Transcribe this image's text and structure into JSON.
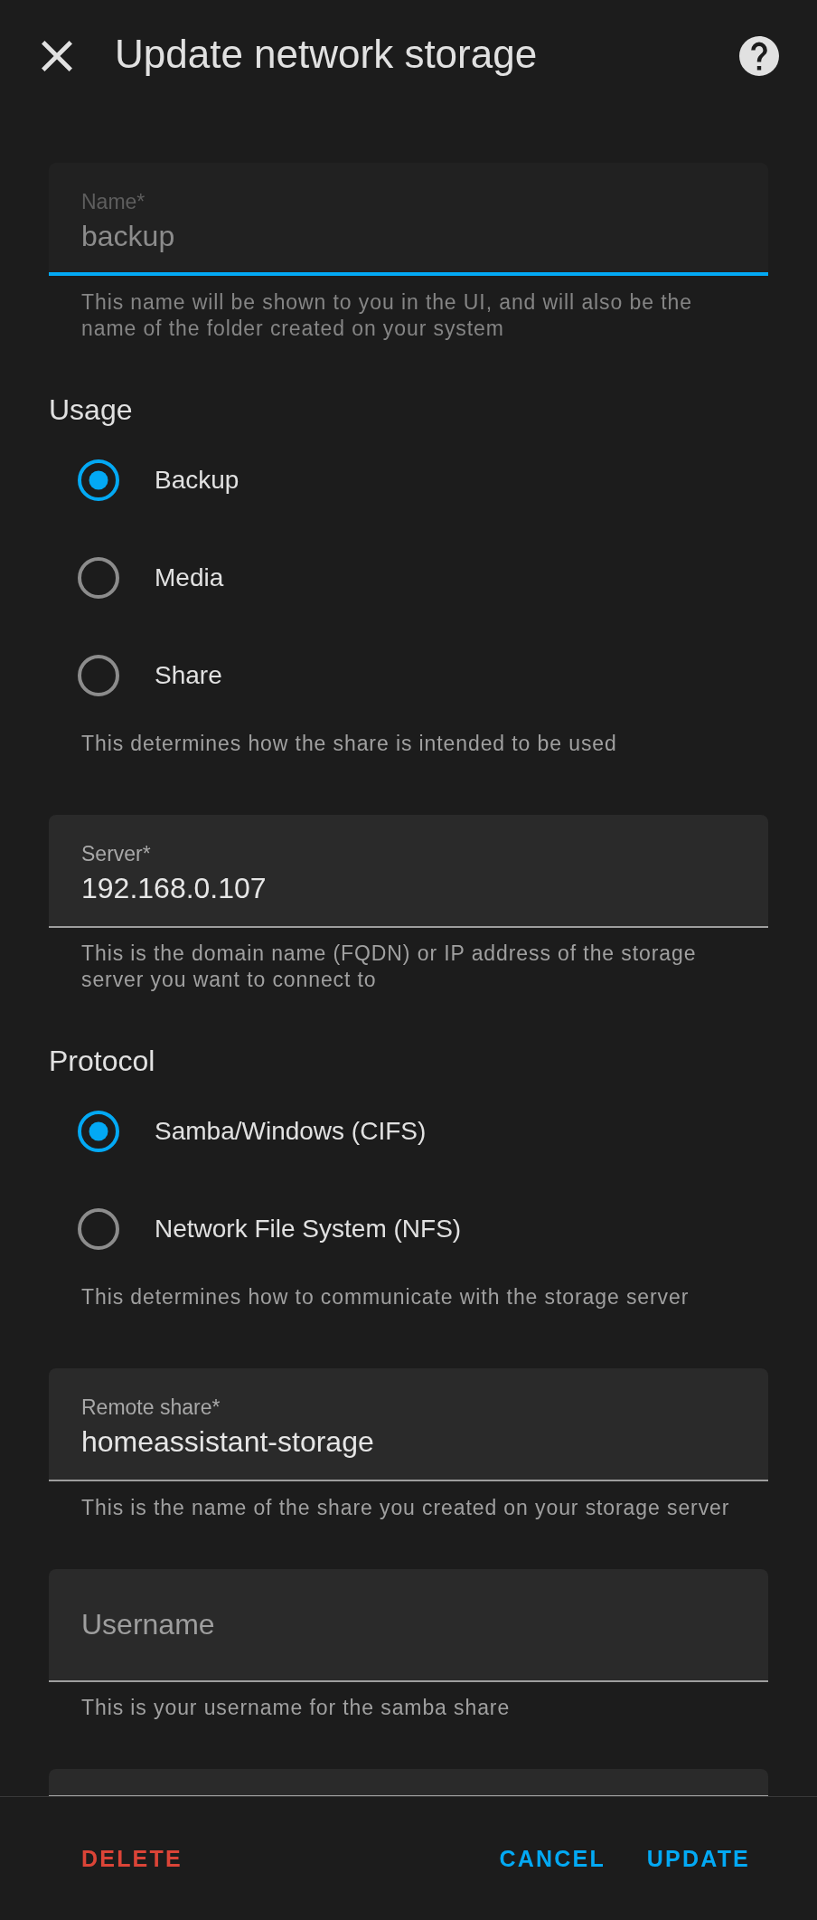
{
  "dialog": {
    "title": "Update network storage"
  },
  "form": [
    {
      "kind": "field",
      "label": "Name*",
      "value": "backup",
      "disabled": true,
      "focused": true,
      "helper": "This name will be shown to you in the UI, and will also be the name of the folder created on your system"
    },
    {
      "kind": "radio_group",
      "heading": "Usage",
      "options": [
        {
          "label": "Backup",
          "selected": true
        },
        {
          "label": "Media",
          "selected": false
        },
        {
          "label": "Share",
          "selected": false
        }
      ],
      "helper": "This determines how the share is intended to be used"
    },
    {
      "kind": "field",
      "label": "Server*",
      "value": "192.168.0.107",
      "disabled": false,
      "focused": false,
      "helper": "This is the domain name (FQDN) or IP address of the storage server you want to connect to"
    },
    {
      "kind": "radio_group",
      "heading": "Protocol",
      "options": [
        {
          "label": "Samba/Windows (CIFS)",
          "selected": true
        },
        {
          "label": "Network File System (NFS)",
          "selected": false
        }
      ],
      "helper": "This determines how to communicate with the storage server"
    },
    {
      "kind": "field",
      "label": "Remote share*",
      "value": "homeassistant-storage",
      "disabled": false,
      "focused": false,
      "helper": "This is the name of the share you created on your storage server"
    },
    {
      "kind": "field",
      "label": "Username",
      "disabled": false,
      "focused": false,
      "helper": "This is your username for the samba share"
    },
    {
      "kind": "field"
    }
  ],
  "actions": [
    {
      "label": "DELETE",
      "kind": "destructive"
    },
    {
      "label": "CANCEL",
      "kind": "default"
    },
    {
      "label": "UPDATE",
      "kind": "default"
    }
  ]
}
